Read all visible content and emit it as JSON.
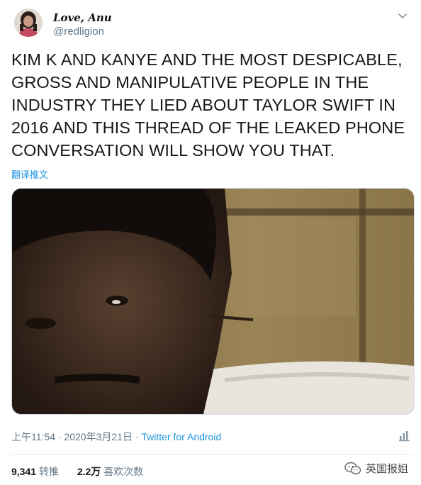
{
  "author": {
    "display_name": "Love, Anu",
    "handle": "@redligion"
  },
  "tweet": {
    "text": "KIM K AND KANYE AND THE MOST DESPICABLE, GROSS AND MANIPULATIVE PEOPLE IN THE INDUSTRY THEY LIED ABOUT TAYLOR SWIFT IN 2016 AND THIS THREAD OF THE LEAKED PHONE CONVERSATION WILL SHOW YOU THAT.",
    "translate_label": "翻译推文",
    "timestamp": "上午11:54 · 2020年3月21日",
    "separator": " · ",
    "source": "Twitter for Android"
  },
  "stats": {
    "retweets_count": "9,341",
    "retweets_label": "转推",
    "likes_count": "2.2万",
    "likes_label": "喜欢次数"
  },
  "watermark": {
    "text": "英国报姐"
  },
  "icons": {
    "caret": "chevron-down-icon",
    "analytics": "analytics-icon",
    "wechat": "wechat-icon"
  },
  "colors": {
    "link": "#1b95e0",
    "secondary_text": "#657786",
    "primary_text": "#14171a"
  }
}
